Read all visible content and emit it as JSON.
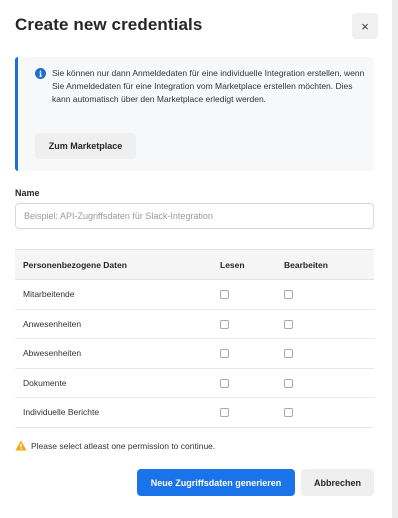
{
  "dialog": {
    "title": "Create new credentials",
    "close_label": "×"
  },
  "info": {
    "icon": "info-icon",
    "text": "Sie können nur dann Anmeldedaten für eine individuelle Integration erstellen, wenn Sie Anmeldedaten für eine Integration vom Marketplace erstellen möchten. Dies kann automatisch über den Marketplace erledigt werden.",
    "button_label": "Zum Marketplace",
    "accent_color": "#1f6fcf"
  },
  "name_field": {
    "label": "Name",
    "value": "",
    "placeholder": "Beispiel: API-Zugriffsdaten für Slack-Integration"
  },
  "permissions": {
    "headers": [
      "Personenbezogene Daten",
      "Lesen",
      "Bearbeiten"
    ],
    "rows": [
      {
        "label": "Mitarbeitende",
        "read": false,
        "edit": false
      },
      {
        "label": "Anwesenheiten",
        "read": false,
        "edit": false
      },
      {
        "label": "Abwesenheiten",
        "read": false,
        "edit": false
      },
      {
        "label": "Dokumente",
        "read": false,
        "edit": false
      },
      {
        "label": "Individuelle Berichte",
        "read": false,
        "edit": false
      }
    ]
  },
  "warning": {
    "icon": "warning-icon",
    "text": "Please select atleast one permission to continue.",
    "color": "#f0a81b"
  },
  "actions": {
    "primary_label": "Neue Zugriffsdaten generieren",
    "primary_color": "#1a73e8",
    "secondary_label": "Abbrechen"
  }
}
